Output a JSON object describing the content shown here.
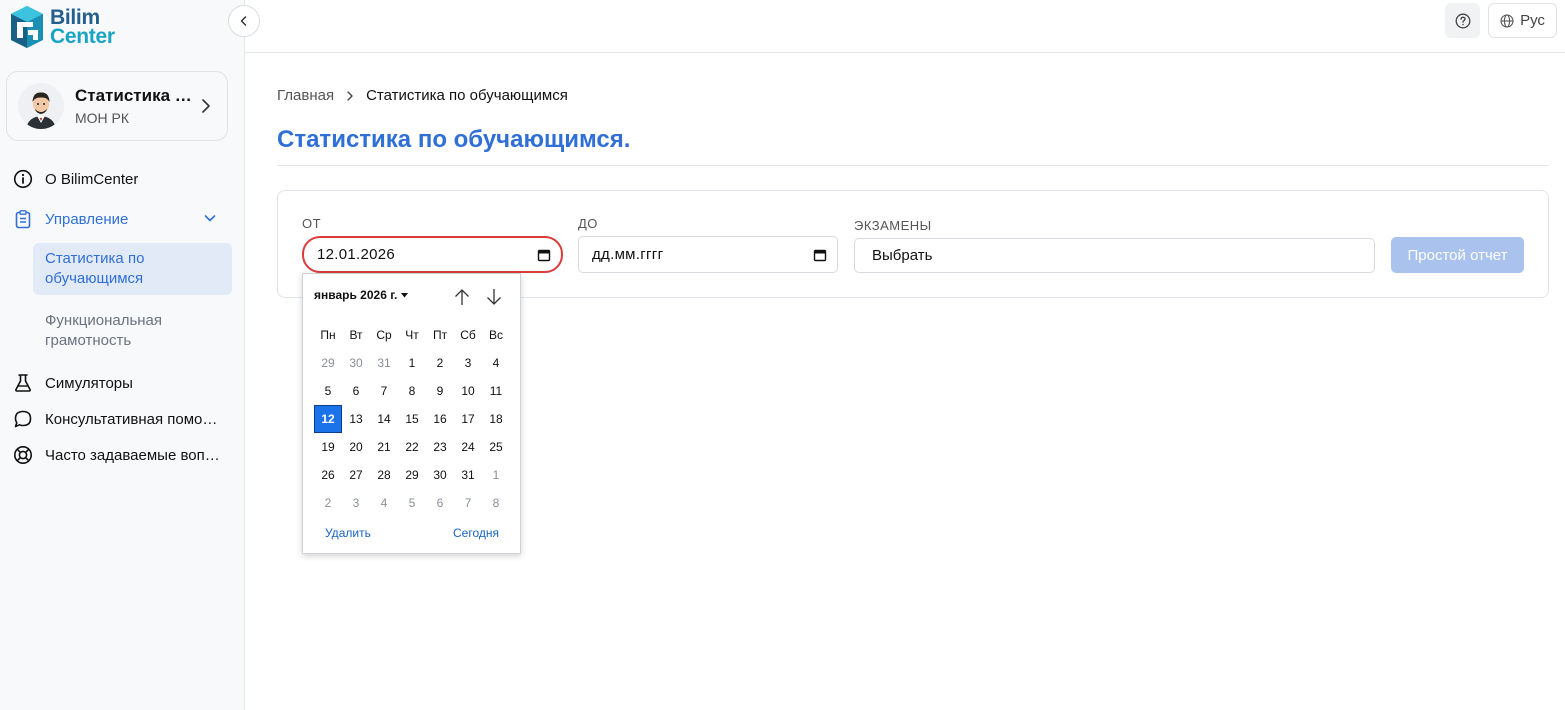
{
  "brand": {
    "line1": "Bilim",
    "line2": "Center"
  },
  "profile": {
    "name": "Статистика МОН РК",
    "org": "МОН РК"
  },
  "sidebar": {
    "items": [
      {
        "label": "О BilimCenter",
        "icon": "info-icon"
      },
      {
        "label": "Управление",
        "icon": "clipboard-icon"
      },
      {
        "label": "Симуляторы",
        "icon": "flask-icon"
      },
      {
        "label": "Консультативная помощь",
        "icon": "chat-bubble-icon"
      },
      {
        "label": "Часто задаваемые вопросы",
        "icon": "lifebuoy-icon"
      }
    ],
    "submenu": [
      {
        "label": "Статистика по обучающимся"
      },
      {
        "label": "Функциональная грамотность"
      }
    ]
  },
  "topbar": {
    "language": "Рус"
  },
  "breadcrumb": {
    "home": "Главная",
    "current": "Статистика по обучающимся"
  },
  "page": {
    "title": "Статистика по обучающимся."
  },
  "filters": {
    "from_label": "ОТ",
    "from_value": "12.01.2026",
    "to_label": "ДО",
    "to_placeholder": "дд.мм.гггг",
    "exams_label": "ЭКЗАМЕНЫ",
    "exams_value": "Выбрать",
    "report_button": "Простой отчет"
  },
  "calendar": {
    "month_label": "январь 2026 г.",
    "weekdays": [
      "Пн",
      "Вт",
      "Ср",
      "Чт",
      "Пт",
      "Сб",
      "Вс"
    ],
    "weeks": [
      [
        "29",
        "30",
        "31",
        "1",
        "2",
        "3",
        "4"
      ],
      [
        "5",
        "6",
        "7",
        "8",
        "9",
        "10",
        "11"
      ],
      [
        "12",
        "13",
        "14",
        "15",
        "16",
        "17",
        "18"
      ],
      [
        "19",
        "20",
        "21",
        "22",
        "23",
        "24",
        "25"
      ],
      [
        "26",
        "27",
        "28",
        "29",
        "30",
        "31",
        "1"
      ],
      [
        "2",
        "3",
        "4",
        "5",
        "6",
        "7",
        "8"
      ]
    ],
    "muted": [
      [
        0,
        0
      ],
      [
        0,
        1
      ],
      [
        0,
        2
      ],
      [
        4,
        6
      ],
      [
        5,
        0
      ],
      [
        5,
        1
      ],
      [
        5,
        2
      ],
      [
        5,
        3
      ],
      [
        5,
        4
      ],
      [
        5,
        5
      ],
      [
        5,
        6
      ]
    ],
    "selected": [
      2,
      0
    ],
    "clear_label": "Удалить",
    "today_label": "Сегодня"
  },
  "colors": {
    "accent": "#2f6fd6",
    "focus_ring": "#dc3b3b",
    "calendar_selected": "#1a73e8",
    "button_disabled": "#a9c3ee"
  }
}
